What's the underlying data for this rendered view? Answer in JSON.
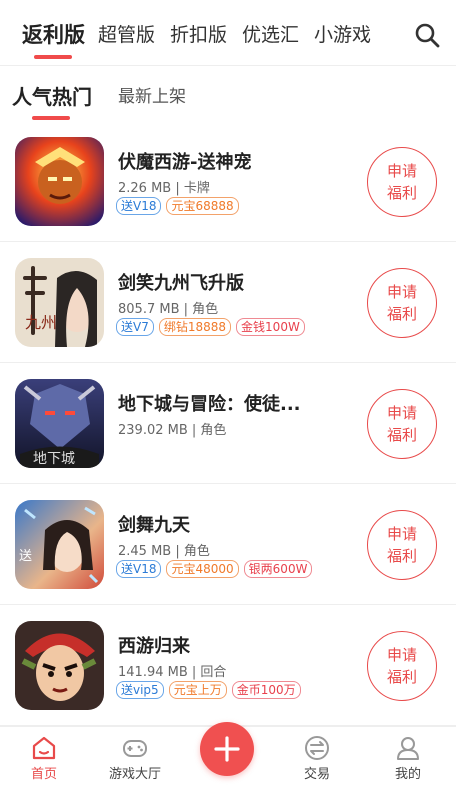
{
  "top_tabs": [
    {
      "label": "返利版",
      "active": true
    },
    {
      "label": "超管版"
    },
    {
      "label": "折扣版"
    },
    {
      "label": "优选汇"
    },
    {
      "label": "小游戏"
    }
  ],
  "sub_tabs": [
    {
      "label": "人气热门",
      "active": true
    },
    {
      "label": "最新上架"
    }
  ],
  "claim_label": [
    "申请",
    "福利"
  ],
  "games": [
    {
      "title": "伏魔西游-送神宠",
      "meta": "2.26 MB | 卡牌",
      "tags": [
        {
          "text": "送V18",
          "color": "blue"
        },
        {
          "text": "元宝68888",
          "color": "orange"
        }
      ]
    },
    {
      "title": "剑笑九州飞升版",
      "meta": "805.7 MB | 角色",
      "tags": [
        {
          "text": "送V7",
          "color": "blue"
        },
        {
          "text": "绑钻18888",
          "color": "orange"
        },
        {
          "text": "金钱100W",
          "color": "red"
        }
      ]
    },
    {
      "title": "地下城与冒险：使徒...",
      "meta": "239.02 MB | 角色",
      "tags": []
    },
    {
      "title": "剑舞九天",
      "meta": "2.45 MB | 角色",
      "tags": [
        {
          "text": "送V18",
          "color": "blue"
        },
        {
          "text": "元宝48000",
          "color": "orange"
        },
        {
          "text": "银两600W",
          "color": "red"
        }
      ]
    },
    {
      "title": "西游归来",
      "meta": "141.94 MB | 回合",
      "tags": [
        {
          "text": "送vip5",
          "color": "blue"
        },
        {
          "text": "元宝上万",
          "color": "orange"
        },
        {
          "text": "金币100万",
          "color": "red"
        }
      ]
    }
  ],
  "bottom_nav": [
    {
      "label": "首页",
      "icon": "home-icon",
      "active": true
    },
    {
      "label": "游戏大厅",
      "icon": "gamepad-icon"
    },
    {
      "label": "交易",
      "icon": "exchange-icon"
    },
    {
      "label": "我的",
      "icon": "user-icon"
    }
  ],
  "colors": {
    "accent": "#f04b4b",
    "tag_blue": "#2b7bd6",
    "tag_orange": "#f07a2a",
    "tag_red": "#e8414d"
  }
}
